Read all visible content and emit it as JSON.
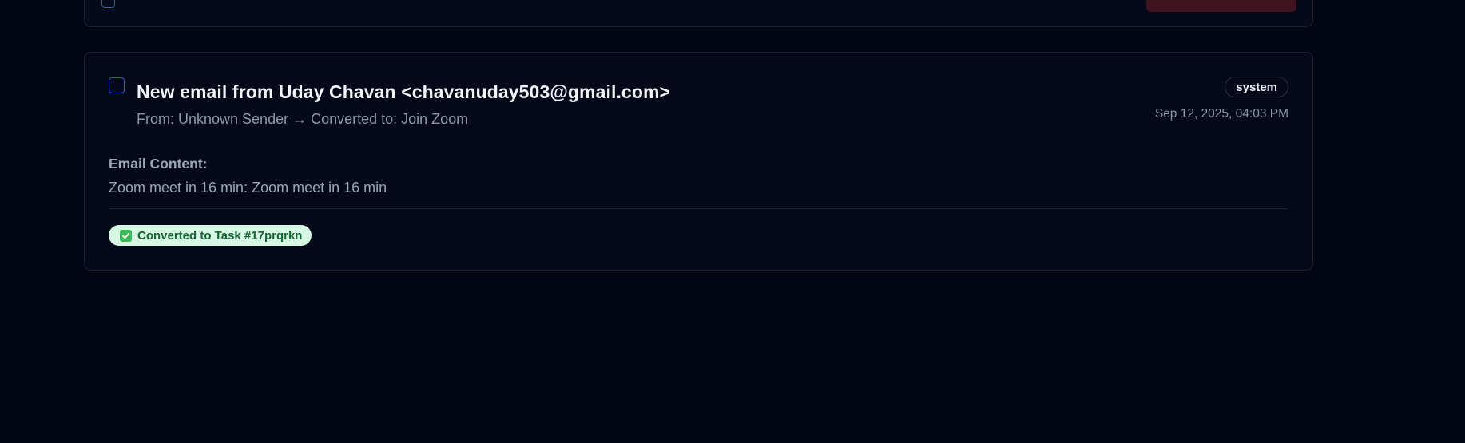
{
  "email_card": {
    "subject": "New email from Uday Chavan <chavanuday503@gmail.com>",
    "from_line": "From: Unknown Sender → Converted to: Join Zoom",
    "type_badge": "system",
    "timestamp": "Sep 12, 2025, 04:03 PM",
    "content_label": "Email Content:",
    "content_body": "Zoom meet in 16 min: Zoom meet in 16 min",
    "converted_label": "Converted to Task #17prqrkn",
    "converted_icon": "check-mark-icon"
  },
  "colors": {
    "background": "#020612",
    "card_border": "#1a2335",
    "checkbox_border": "#2b5bd7",
    "pill_background": "#d6f7e3",
    "pill_text": "#166534",
    "delete_button": "#3f1420"
  }
}
